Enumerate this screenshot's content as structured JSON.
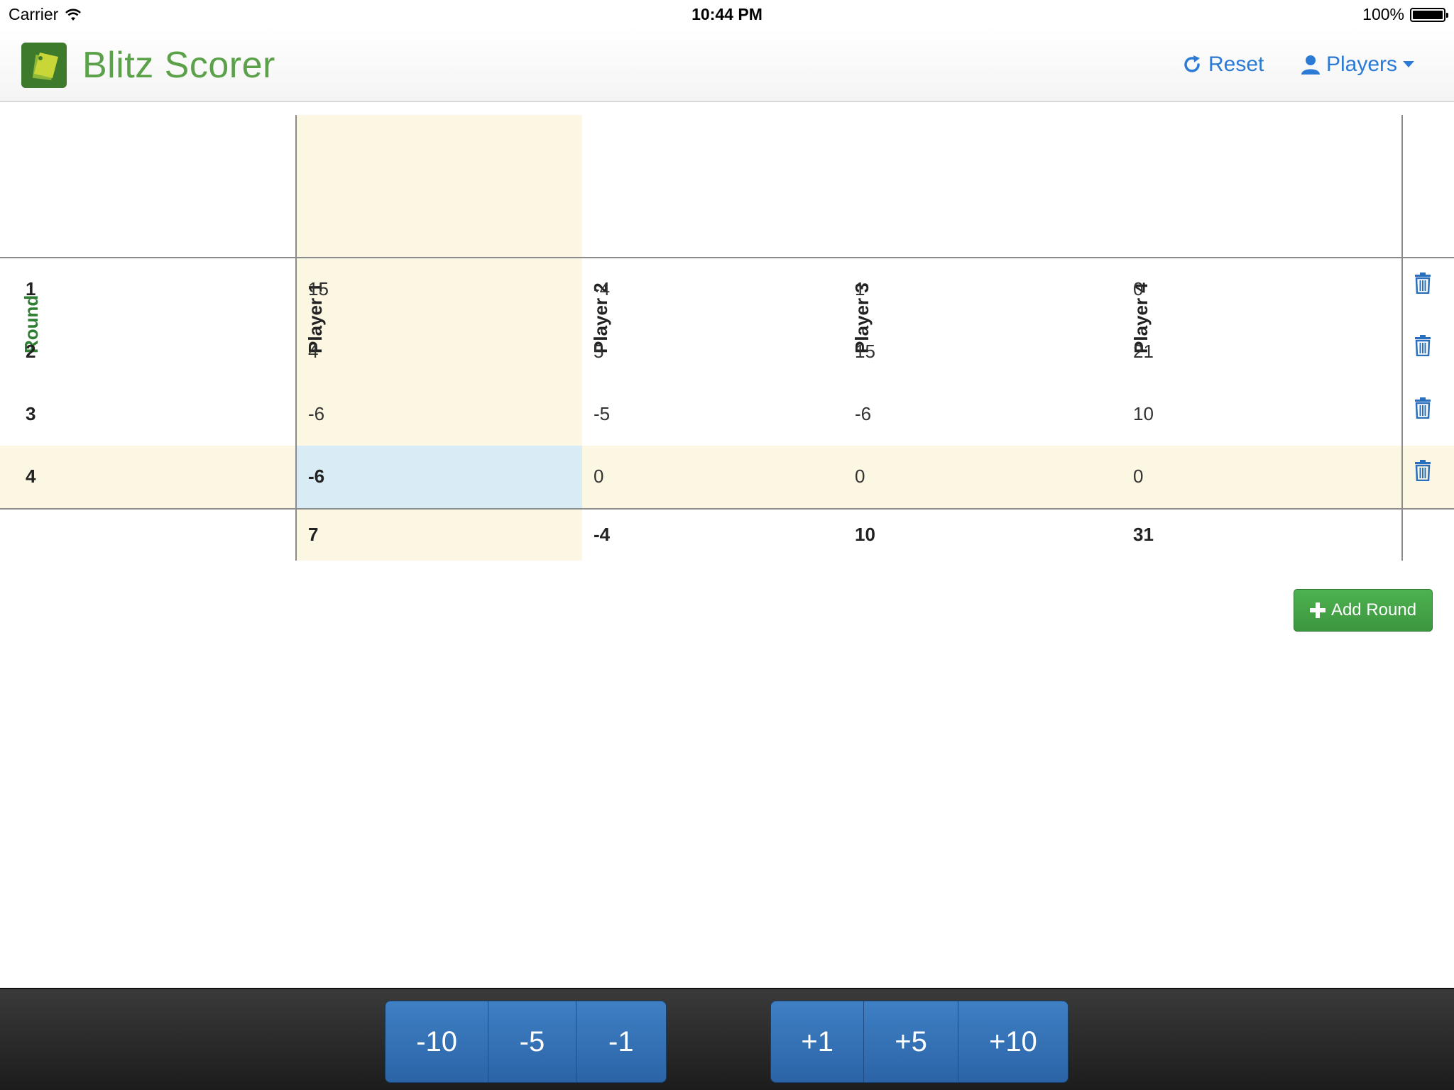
{
  "status_bar": {
    "carrier": "Carrier",
    "time": "10:44 PM",
    "battery": "100%"
  },
  "navbar": {
    "title": "Blitz Scorer",
    "reset_label": "Reset",
    "players_label": "Players"
  },
  "table": {
    "round_header": "Round",
    "players": [
      "Player 1",
      "Player 2",
      "Player 3",
      "Player 4"
    ],
    "rows": [
      {
        "round": "1",
        "scores": [
          "15",
          "-4",
          "1",
          "0"
        ]
      },
      {
        "round": "2",
        "scores": [
          "4",
          "5",
          "15",
          "21"
        ]
      },
      {
        "round": "3",
        "scores": [
          "-6",
          "-5",
          "-6",
          "10"
        ]
      },
      {
        "round": "4",
        "scores": [
          "-6",
          "0",
          "0",
          "0"
        ]
      }
    ],
    "totals": [
      "7",
      "-4",
      "10",
      "31"
    ]
  },
  "add_round_label": "Add Round",
  "adjust_buttons": {
    "minus": [
      "-10",
      "-5",
      "-1"
    ],
    "plus": [
      "+1",
      "+5",
      "+10"
    ]
  },
  "colors": {
    "brand_green": "#5aa14a",
    "link_blue": "#2a7ad6",
    "highlight": "#fcf7e3",
    "selected_cell": "#d9ebf5",
    "button_blue": "#2b64a7",
    "add_button_green": "#3c963f"
  }
}
